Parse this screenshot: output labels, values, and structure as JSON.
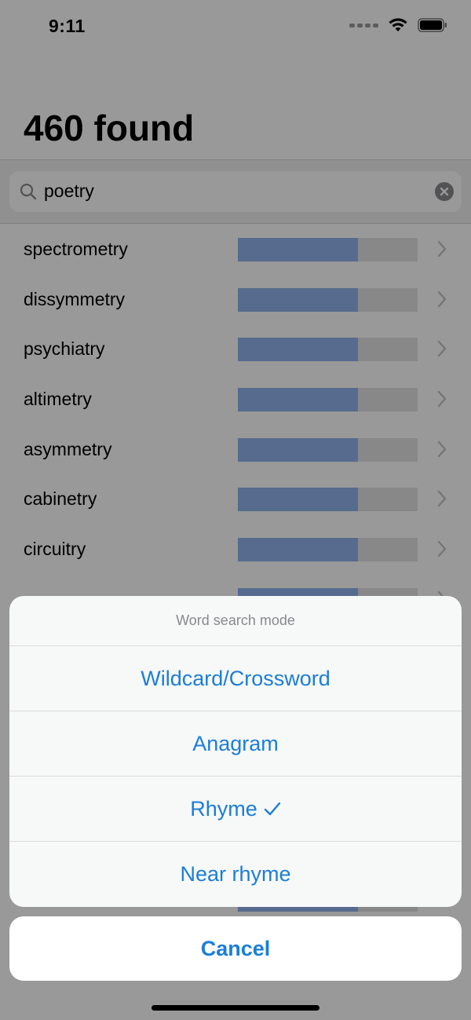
{
  "status_bar": {
    "time": "9:11"
  },
  "header": {
    "title": "460 found"
  },
  "search": {
    "query": "poetry"
  },
  "results": [
    {
      "word": "spectrometry",
      "score": 0.67
    },
    {
      "word": "dissymmetry",
      "score": 0.67
    },
    {
      "word": "psychiatry",
      "score": 0.67
    },
    {
      "word": "altimetry",
      "score": 0.67
    },
    {
      "word": "asymmetry",
      "score": 0.67
    },
    {
      "word": "cabinetry",
      "score": 0.67
    },
    {
      "word": "circuitry",
      "score": 0.67
    },
    {
      "word": "",
      "score": 0.67
    },
    {
      "word": "",
      "score": 0.67
    },
    {
      "word": "",
      "score": 0.67
    },
    {
      "word": "",
      "score": 0.67
    },
    {
      "word": "",
      "score": 0.67
    },
    {
      "word": "",
      "score": 0.67
    },
    {
      "word": "",
      "score": 0.67
    }
  ],
  "action_sheet": {
    "title": "Word search mode",
    "options": [
      {
        "label": "Wildcard/Crossword",
        "selected": false
      },
      {
        "label": "Anagram",
        "selected": false
      },
      {
        "label": "Rhyme",
        "selected": true
      },
      {
        "label": "Near rhyme",
        "selected": false
      }
    ],
    "cancel_label": "Cancel"
  },
  "colors": {
    "accent": "#1a7ed9",
    "score_fill": "#8fb3ec",
    "score_track": "#e3e3e3"
  },
  "icons": {
    "search": "magnifier-icon",
    "clear": "clear-circle-icon",
    "chevron": "chevron-right-icon",
    "check": "checkmark-icon",
    "wifi": "wifi-icon",
    "battery": "battery-icon",
    "signal": "signal-icon"
  }
}
